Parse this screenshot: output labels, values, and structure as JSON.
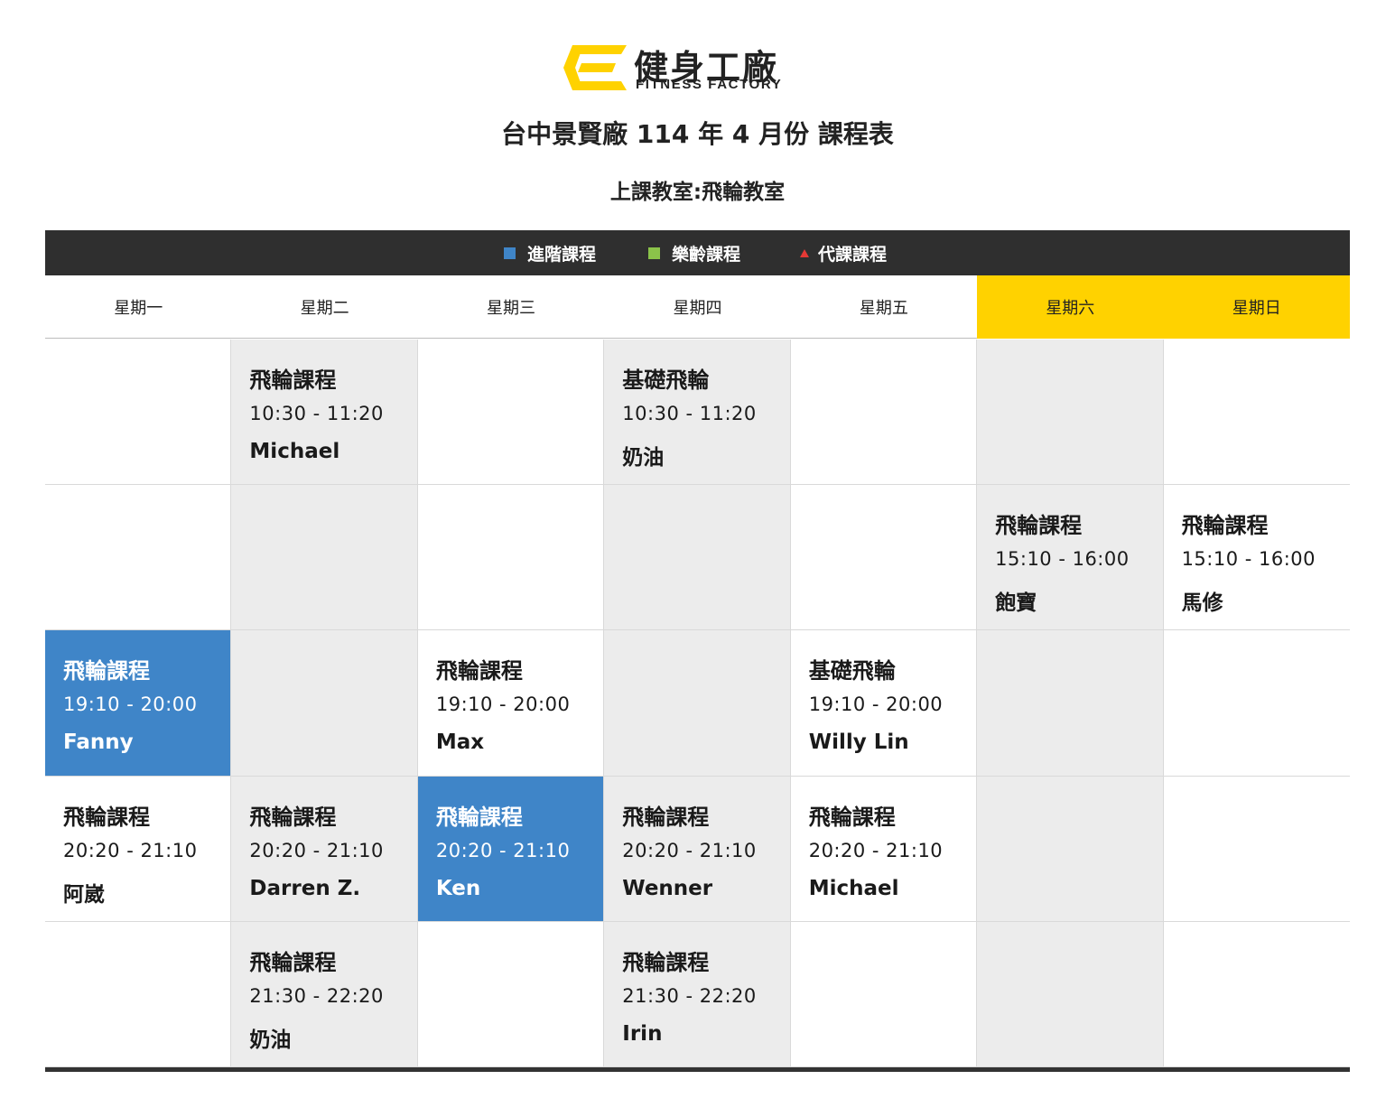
{
  "logo": {
    "zh": "健身工廠",
    "en": "FITNESS FACTORY",
    "brand_color": "#ffd200"
  },
  "title": "台中景賢廠 114 年 4 月份 課程表",
  "subtitle": "上課教室:飛輪教室",
  "legend": [
    {
      "label": "進階課程",
      "color": "#3f85c8",
      "shape": "square"
    },
    {
      "label": "樂齡課程",
      "color": "#8bc34a",
      "shape": "square"
    },
    {
      "label": "代課課程",
      "color": "#e53935",
      "shape": "triangle"
    }
  ],
  "days": [
    "星期一",
    "星期二",
    "星期三",
    "星期四",
    "星期五",
    "星期六",
    "星期日"
  ],
  "colors": {
    "header_bar": "#2f2f2f",
    "weekend": "#ffd200",
    "advanced": "#3f85c8",
    "shaded": "#ececec"
  },
  "schedule": [
    [
      null,
      {
        "name": "飛輪課程",
        "time": "10:30 - 11:20",
        "instructor": "Michael"
      },
      null,
      {
        "name": "基礎飛輪",
        "time": "10:30 - 11:20",
        "instructor": "奶油"
      },
      null,
      null,
      null
    ],
    [
      null,
      null,
      null,
      null,
      null,
      {
        "name": "飛輪課程",
        "time": "15:10 - 16:00",
        "instructor": "飽寶"
      },
      {
        "name": "飛輪課程",
        "time": "15:10 - 16:00",
        "instructor": "馬修"
      }
    ],
    [
      {
        "name": "飛輪課程",
        "time": "19:10 - 20:00",
        "instructor": "Fanny",
        "type": "advanced"
      },
      null,
      {
        "name": "飛輪課程",
        "time": "19:10 - 20:00",
        "instructor": "Max"
      },
      null,
      {
        "name": "基礎飛輪",
        "time": "19:10 - 20:00",
        "instructor": "Willy Lin"
      },
      null,
      null
    ],
    [
      {
        "name": "飛輪課程",
        "time": "20:20 - 21:10",
        "instructor": "阿崴"
      },
      {
        "name": "飛輪課程",
        "time": "20:20 - 21:10",
        "instructor": "Darren Z."
      },
      {
        "name": "飛輪課程",
        "time": "20:20 - 21:10",
        "instructor": "Ken",
        "type": "advanced"
      },
      {
        "name": "飛輪課程",
        "time": "20:20 - 21:10",
        "instructor": "Wenner"
      },
      {
        "name": "飛輪課程",
        "time": "20:20 - 21:10",
        "instructor": "Michael"
      },
      null,
      null
    ],
    [
      null,
      {
        "name": "飛輪課程",
        "time": "21:30 - 22:20",
        "instructor": "奶油"
      },
      null,
      {
        "name": "飛輪課程",
        "time": "21:30 - 22:20",
        "instructor": "Irin"
      },
      null,
      null,
      null
    ]
  ]
}
